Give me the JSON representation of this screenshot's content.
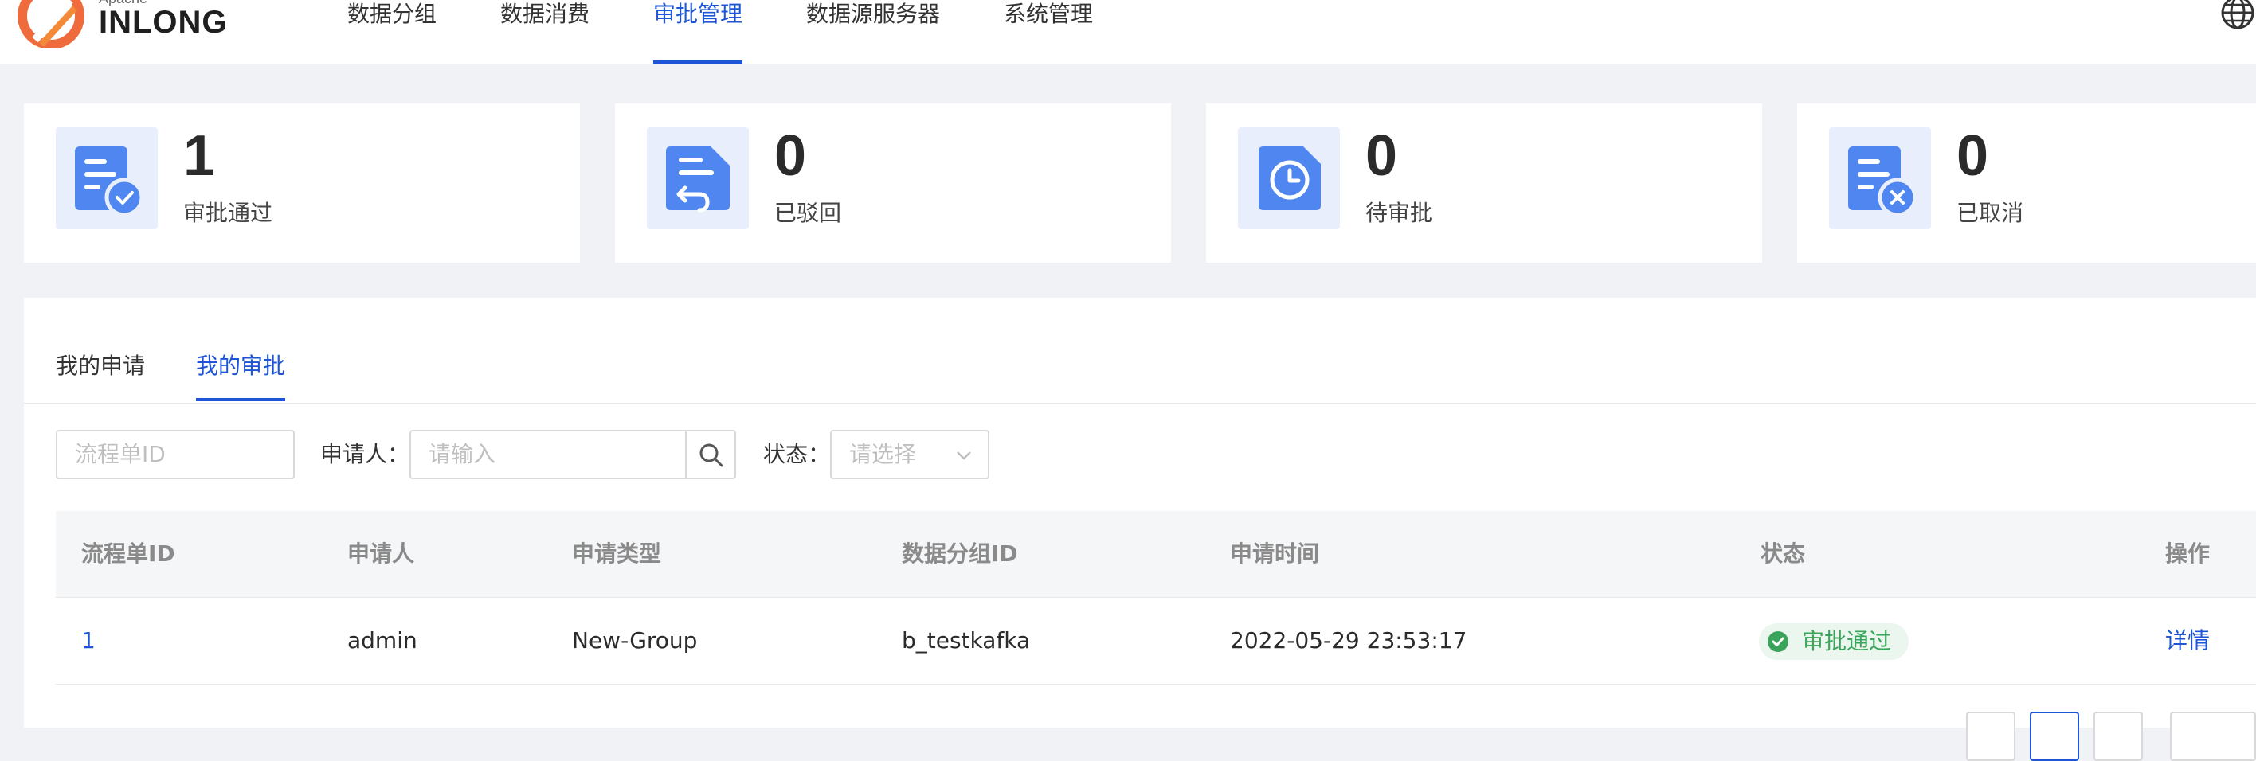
{
  "brand": {
    "small": "Apache",
    "name": "INLONG"
  },
  "nav": {
    "items": [
      {
        "label": "数据分组"
      },
      {
        "label": "数据消费"
      },
      {
        "label": "审批管理"
      },
      {
        "label": "数据源服务器"
      },
      {
        "label": "系统管理"
      }
    ],
    "active_index": 2
  },
  "stats": [
    {
      "count": "1",
      "label": "审批通过",
      "icon": "approved-doc-icon"
    },
    {
      "count": "0",
      "label": "已驳回",
      "icon": "rejected-doc-icon"
    },
    {
      "count": "0",
      "label": "待审批",
      "icon": "pending-doc-icon"
    },
    {
      "count": "0",
      "label": "已取消",
      "icon": "cancelled-doc-icon"
    }
  ],
  "tabs": [
    {
      "label": "我的申请"
    },
    {
      "label": "我的审批"
    }
  ],
  "filters": {
    "process_id_placeholder": "流程单ID",
    "applicant_label": "申请人",
    "applicant_placeholder": "请输入",
    "status_label": "状态",
    "status_placeholder": "请选择"
  },
  "table": {
    "columns": [
      "流程单ID",
      "申请人",
      "申请类型",
      "数据分组ID",
      "申请时间",
      "状态",
      "操作"
    ],
    "rows": [
      {
        "id": "1",
        "applicant": "admin",
        "type": "New-Group",
        "group_id": "b_testkafka",
        "time": "2022-05-29 23:53:17",
        "status": "审批通过",
        "action": "详情"
      }
    ]
  },
  "colors": {
    "accent": "#1d55d6",
    "icon_blue": "#4f86f0",
    "success": "#3aa55a"
  }
}
